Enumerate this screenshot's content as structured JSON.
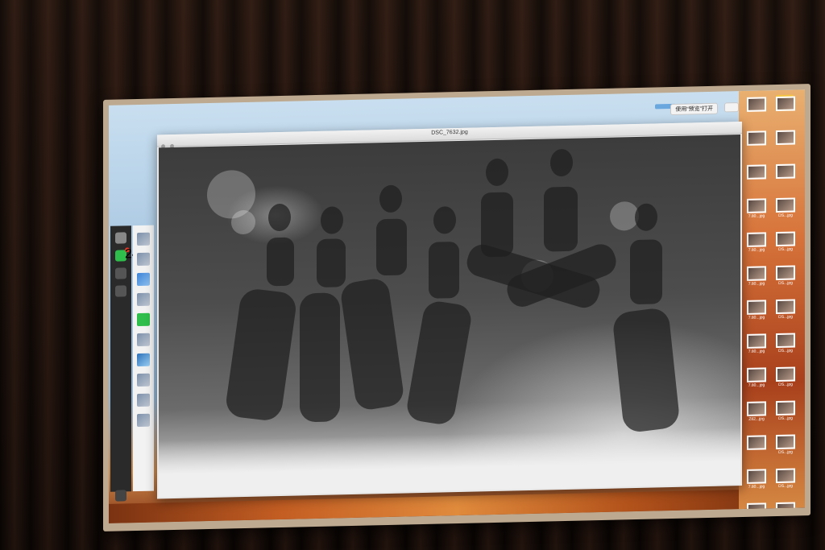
{
  "scene": {
    "description_tags": [
      "monitor",
      "curtain",
      "photo-viewer"
    ]
  },
  "viewer": {
    "window_title": "DSC_7632.jpg",
    "open_with_label": "使用“预览”打开"
  },
  "finder": {
    "thumbnails": [
      {
        "caption": ""
      },
      {
        "caption": ""
      },
      {
        "caption": ""
      },
      {
        "caption": ""
      },
      {
        "caption": ""
      },
      {
        "caption": ""
      },
      {
        "caption": "7.80...jpg"
      },
      {
        "caption": "DS...jpg"
      },
      {
        "caption": "7.80...jpg"
      },
      {
        "caption": "DS...jpg"
      },
      {
        "caption": "7.80...jpg"
      },
      {
        "caption": "DS...jpg"
      },
      {
        "caption": "7.80...jpg"
      },
      {
        "caption": "DS...jpg"
      },
      {
        "caption": "7.80...jpg"
      },
      {
        "caption": "DS...jpg"
      },
      {
        "caption": "7.80...jpg"
      },
      {
        "caption": "DS...jpg"
      },
      {
        "caption": "Z82...jpg"
      },
      {
        "caption": "DS...jpg"
      },
      {
        "caption": ""
      },
      {
        "caption": "DS...jpg"
      },
      {
        "caption": "7.80...jpg"
      },
      {
        "caption": "DS...jpg"
      },
      {
        "caption": "黄埔...mp4"
      },
      {
        "caption": "DS...jpg"
      },
      {
        "caption": "之后...jpg"
      },
      {
        "caption": "DS...jpg"
      }
    ]
  },
  "dock": {
    "badge_count": "24"
  }
}
